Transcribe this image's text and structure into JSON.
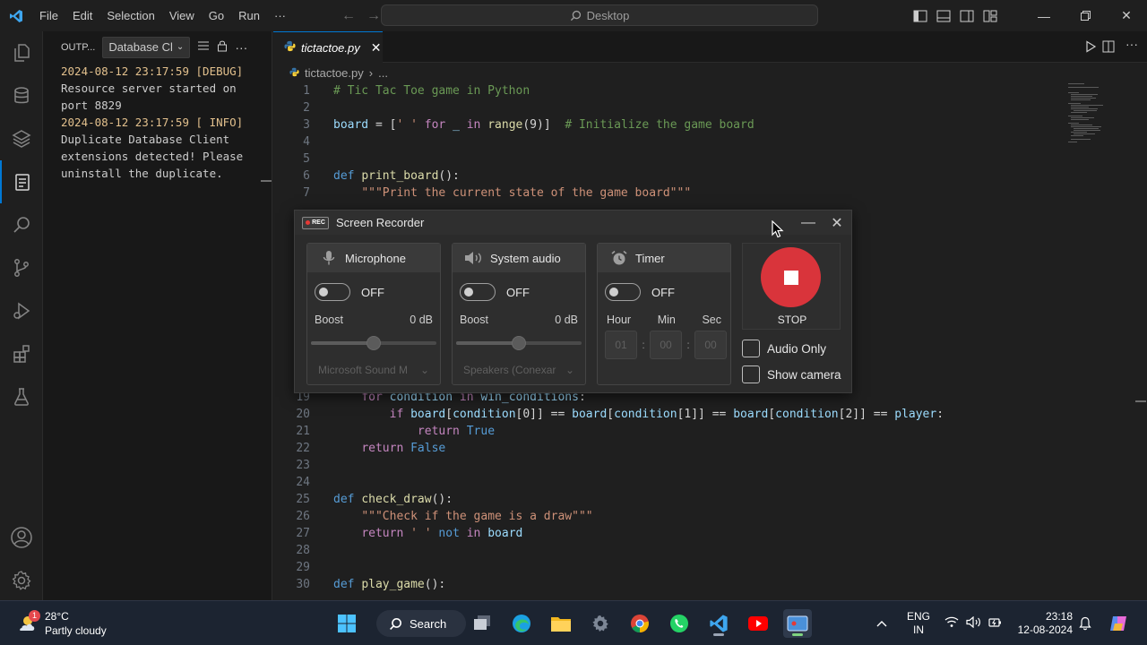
{
  "titlebar": {
    "menu": [
      "File",
      "Edit",
      "Selection",
      "View",
      "Go",
      "Run",
      "···"
    ],
    "search_text": "Desktop",
    "window_controls": [
      "minimize-icon",
      "restore-icon",
      "close-icon"
    ]
  },
  "output_panel": {
    "title": "OUTP...",
    "channel": "Database Cl",
    "log": [
      {
        "timestamp": "2024-08-12 23:17:59",
        "level": "[DEBUG]",
        "message": "Resource server started on port 8829"
      },
      {
        "timestamp": "2024-08-12 23:17:59",
        "level": "[ INFO]",
        "message": "Duplicate Database Client extensions detected! Please uninstall the duplicate."
      }
    ]
  },
  "editor": {
    "tab_label": "tictactoe.py",
    "breadcrumb_file": "tictactoe.py",
    "breadcrumb_more": "...",
    "lines_top": [
      {
        "n": "1",
        "tokens": [
          [
            "cm",
            "# Tic Tac Toe game in Python"
          ]
        ]
      },
      {
        "n": "2",
        "tokens": []
      },
      {
        "n": "3",
        "tokens": [
          [
            "var",
            "board"
          ],
          [
            "txt",
            " = ["
          ],
          [
            "str",
            "' '"
          ],
          [
            "txt",
            " "
          ],
          [
            "kw",
            "for"
          ],
          [
            "txt",
            " "
          ],
          [
            "var",
            "_"
          ],
          [
            "txt",
            " "
          ],
          [
            "kw",
            "in"
          ],
          [
            "txt",
            " "
          ],
          [
            "fn",
            "range"
          ],
          [
            "txt",
            "(9)]  "
          ],
          [
            "cm",
            "# Initialize the game board"
          ]
        ]
      },
      {
        "n": "4",
        "tokens": []
      },
      {
        "n": "5",
        "tokens": []
      },
      {
        "n": "6",
        "tokens": [
          [
            "kw2",
            "def"
          ],
          [
            "txt",
            " "
          ],
          [
            "fn",
            "print_board"
          ],
          [
            "txt",
            "():"
          ]
        ]
      },
      {
        "n": "7",
        "tokens": [
          [
            "txt",
            "    "
          ],
          [
            "str",
            "\"\"\"Print the current state of the game board\"\"\""
          ]
        ]
      }
    ],
    "lines_bottom": [
      {
        "n": "19",
        "tokens": [
          [
            "txt",
            "    "
          ],
          [
            "kw",
            "for"
          ],
          [
            "txt",
            " "
          ],
          [
            "var",
            "condition"
          ],
          [
            "txt",
            " "
          ],
          [
            "kw",
            "in"
          ],
          [
            "txt",
            " "
          ],
          [
            "var",
            "win_conditions"
          ],
          [
            "txt",
            ":"
          ]
        ]
      },
      {
        "n": "20",
        "tokens": [
          [
            "txt",
            "        "
          ],
          [
            "kw",
            "if"
          ],
          [
            "txt",
            " "
          ],
          [
            "var",
            "board"
          ],
          [
            "txt",
            "["
          ],
          [
            "var",
            "condition"
          ],
          [
            "txt",
            "[0]] == "
          ],
          [
            "var",
            "board"
          ],
          [
            "txt",
            "["
          ],
          [
            "var",
            "condition"
          ],
          [
            "txt",
            "[1]] == "
          ],
          [
            "var",
            "board"
          ],
          [
            "txt",
            "["
          ],
          [
            "var",
            "condition"
          ],
          [
            "txt",
            "[2]] == "
          ],
          [
            "var",
            "player"
          ],
          [
            "txt",
            ":"
          ]
        ]
      },
      {
        "n": "21",
        "tokens": [
          [
            "txt",
            "            "
          ],
          [
            "kw",
            "return"
          ],
          [
            "txt",
            " "
          ],
          [
            "kw2",
            "True"
          ]
        ]
      },
      {
        "n": "22",
        "tokens": [
          [
            "txt",
            "    "
          ],
          [
            "kw",
            "return"
          ],
          [
            "txt",
            " "
          ],
          [
            "kw2",
            "False"
          ]
        ]
      },
      {
        "n": "23",
        "tokens": []
      },
      {
        "n": "24",
        "tokens": []
      },
      {
        "n": "25",
        "tokens": [
          [
            "kw2",
            "def"
          ],
          [
            "txt",
            " "
          ],
          [
            "fn",
            "check_draw"
          ],
          [
            "txt",
            "():"
          ]
        ]
      },
      {
        "n": "26",
        "tokens": [
          [
            "txt",
            "    "
          ],
          [
            "str",
            "\"\"\"Check if the game is a draw\"\"\""
          ]
        ]
      },
      {
        "n": "27",
        "tokens": [
          [
            "txt",
            "    "
          ],
          [
            "kw",
            "return"
          ],
          [
            "txt",
            " "
          ],
          [
            "str",
            "' '"
          ],
          [
            "txt",
            " "
          ],
          [
            "kw2",
            "not"
          ],
          [
            "txt",
            " "
          ],
          [
            "kw",
            "in"
          ],
          [
            "txt",
            " "
          ],
          [
            "var",
            "board"
          ]
        ]
      },
      {
        "n": "28",
        "tokens": []
      },
      {
        "n": "29",
        "tokens": []
      },
      {
        "n": "30",
        "tokens": [
          [
            "kw2",
            "def"
          ],
          [
            "txt",
            " "
          ],
          [
            "fn",
            "play_game"
          ],
          [
            "txt",
            "():"
          ]
        ]
      }
    ]
  },
  "recorder": {
    "title": "Screen Recorder",
    "logo_text": "REC",
    "microphone": {
      "label": "Microphone",
      "state": "OFF",
      "boost_label": "Boost",
      "boost_value": "0 dB",
      "boost_level": 0.5,
      "device": "Microsoft Sound M"
    },
    "system_audio": {
      "label": "System audio",
      "state": "OFF",
      "boost_label": "Boost",
      "boost_value": "0 dB",
      "boost_level": 0.5,
      "device": "Speakers (Conexar"
    },
    "timer": {
      "label": "Timer",
      "state": "OFF",
      "hour_label": "Hour",
      "min_label": "Min",
      "sec_label": "Sec",
      "hour": "01",
      "min": "00",
      "sec": "00"
    },
    "stop_label": "STOP",
    "audio_only_label": "Audio Only",
    "show_camera_label": "Show camera"
  },
  "taskbar": {
    "weather_temp": "28°C",
    "weather_cond": "Partly cloudy",
    "weather_badge": "1",
    "search_label": "Search",
    "lang_top": "ENG",
    "lang_bottom": "IN",
    "time": "23:18",
    "date": "12-08-2024"
  },
  "colors": {
    "accent": "#0078d4",
    "stop_red": "#d9343b",
    "editor_bg": "#1f1f1f"
  }
}
